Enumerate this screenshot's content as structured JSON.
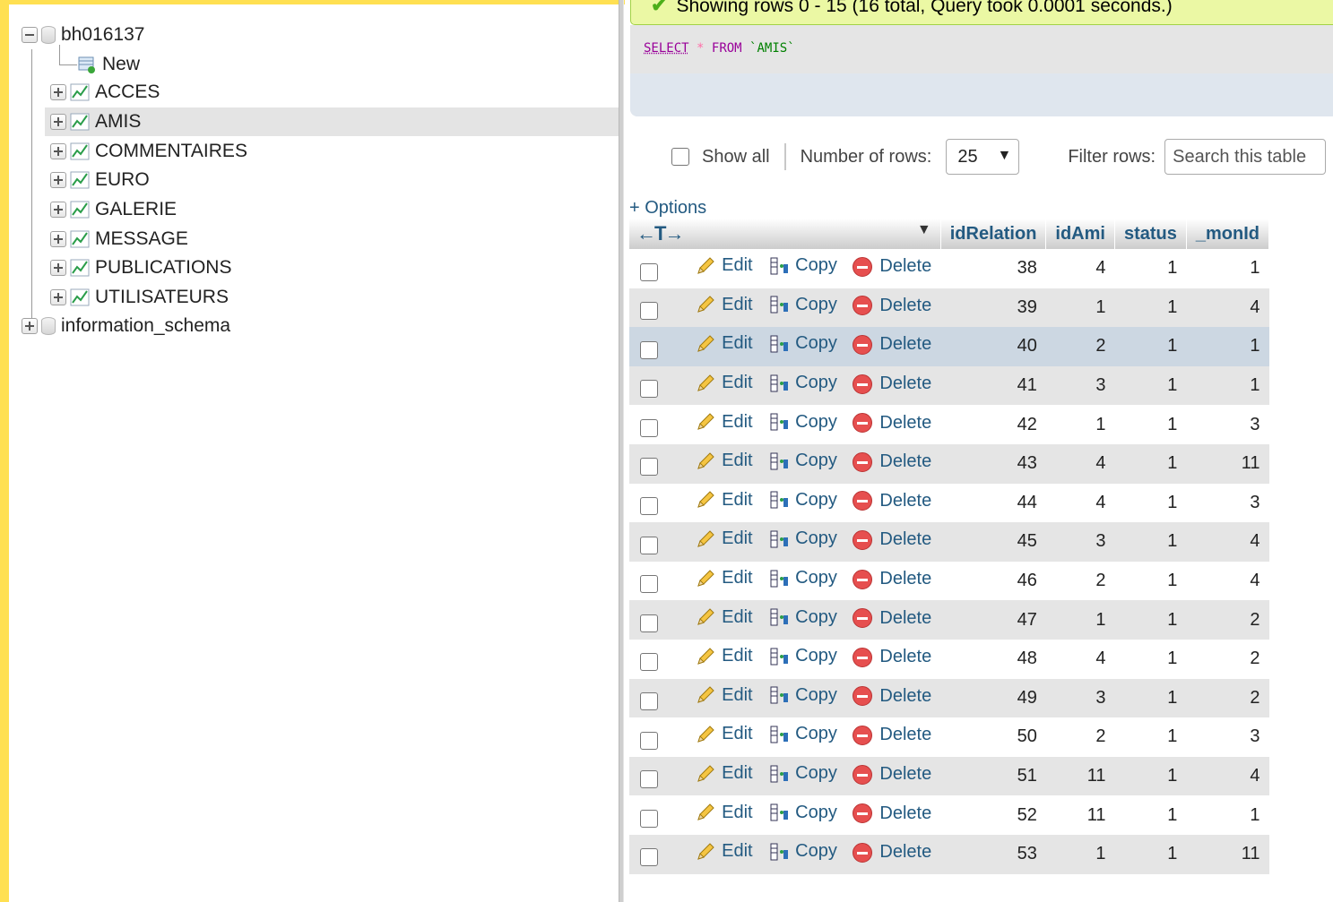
{
  "nav": {
    "db1": "bh016137",
    "new_label": "New",
    "tables": [
      "ACCES",
      "AMIS",
      "COMMENTAIRES",
      "EURO",
      "GALERIE",
      "MESSAGE",
      "PUBLICATIONS",
      "UTILISATEURS"
    ],
    "db2": "information_schema",
    "selected_table": "AMIS"
  },
  "result": {
    "message": "Showing rows 0 - 15 (16 total, Query took 0.0001 seconds.)",
    "sql": {
      "select": "SELECT",
      "star": "*",
      "from": "FROM",
      "table": "`AMIS`"
    }
  },
  "controls": {
    "show_all": "Show all",
    "num_rows_label": "Number of rows:",
    "num_rows_value": "25",
    "filter_label": "Filter rows:",
    "search_placeholder": "Search this table"
  },
  "options_label": "+ Options",
  "actions": {
    "edit": "Edit",
    "copy": "Copy",
    "delete": "Delete"
  },
  "columns": [
    "idRelation",
    "idAmi",
    "status",
    "_monId"
  ],
  "rows": [
    [
      "38",
      "4",
      "1",
      "1"
    ],
    [
      "39",
      "1",
      "1",
      "4"
    ],
    [
      "40",
      "2",
      "1",
      "1"
    ],
    [
      "41",
      "3",
      "1",
      "1"
    ],
    [
      "42",
      "1",
      "1",
      "3"
    ],
    [
      "43",
      "4",
      "1",
      "11"
    ],
    [
      "44",
      "4",
      "1",
      "3"
    ],
    [
      "45",
      "3",
      "1",
      "4"
    ],
    [
      "46",
      "2",
      "1",
      "4"
    ],
    [
      "47",
      "1",
      "1",
      "2"
    ],
    [
      "48",
      "4",
      "1",
      "2"
    ],
    [
      "49",
      "3",
      "1",
      "2"
    ],
    [
      "50",
      "2",
      "1",
      "3"
    ],
    [
      "51",
      "11",
      "1",
      "4"
    ],
    [
      "52",
      "11",
      "1",
      "1"
    ],
    [
      "53",
      "1",
      "1",
      "11"
    ]
  ],
  "colors": {
    "link": "#235a81",
    "frame": "#ffe052",
    "success_bg": "#ebf8a4"
  }
}
